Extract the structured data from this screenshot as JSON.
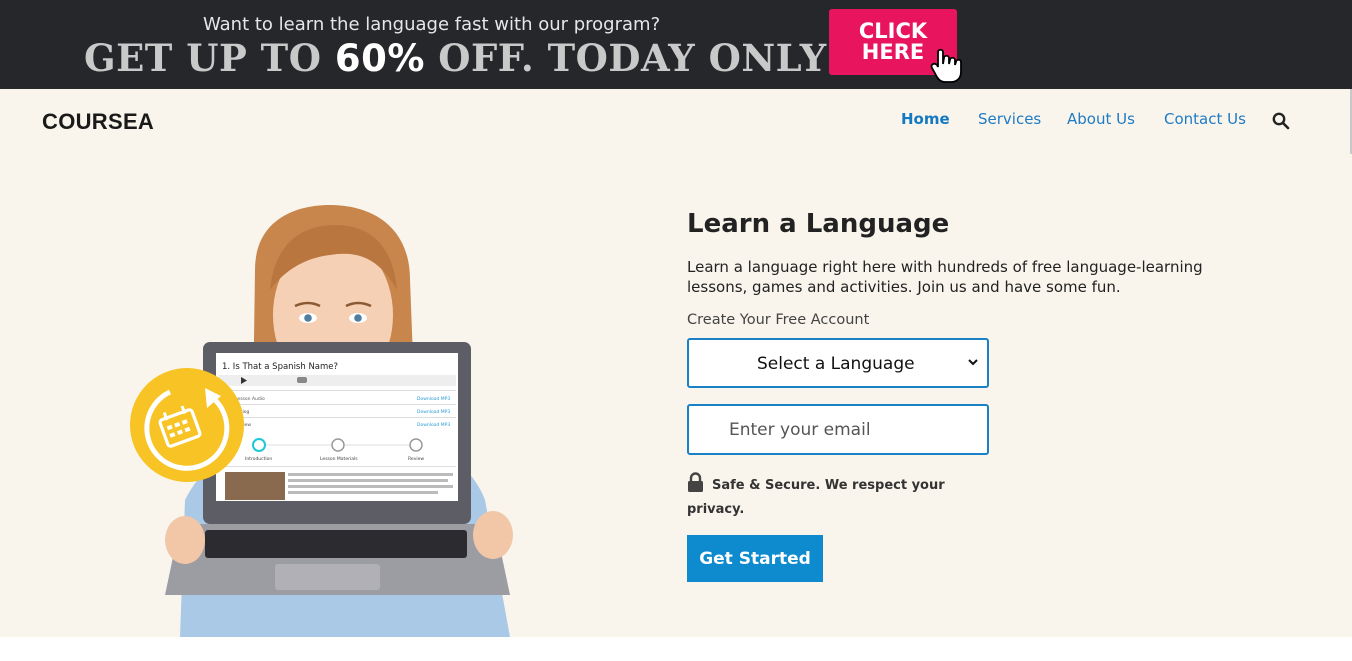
{
  "promo": {
    "line1": "Want to learn the language fast with our program?",
    "line2_prefix": "GET UP TO ",
    "line2_highlight": "60%",
    "line2_suffix": " OFF. TODAY ONLY!",
    "button_line1": "CLICK",
    "button_line2": "HERE"
  },
  "header": {
    "brand": "COURSEA",
    "nav": [
      "Home",
      "Services",
      "About Us",
      "Contact Us"
    ],
    "active_nav": "Home"
  },
  "hero": {
    "heading": "Learn a Language",
    "description": "Learn a language right here with hundreds of free language-learning lessons, games and activities. Join us and have some fun.",
    "form_label": "Create Your Free Account",
    "language_select": "Select a Language",
    "email_placeholder": "Enter your email",
    "secure_text": "Safe & Secure. We respect your privacy.",
    "cta_label": "Get Started"
  },
  "illustration": {
    "screen_title": "1. Is That a Spanish Name?",
    "row_labels": [
      "Lesson Audio",
      "Dialog",
      "Review"
    ],
    "download_label": "Download MP3",
    "steps": [
      "Introduction",
      "Lesson Materials",
      "Review"
    ],
    "lesson_text": "Learn Spanish with SpanishPod101.com! It's a new year, and you've decided you need to learn how to cook some Spanish food. Though you've lived alone for a while now, instead of learning to cook Spanish food, you've been a"
  },
  "colors": {
    "banner_bg": "#25272b",
    "promo_button": "#e8155e",
    "hero_bg": "#f9f5ec",
    "accent_blue": "#0e8bcf",
    "nav_link": "#1f7bc4",
    "badge_yellow": "#f7c325"
  },
  "icons": [
    "pointer-hand-icon",
    "search-icon",
    "chevron-down-icon",
    "lock-icon",
    "calendar-refresh-icon"
  ]
}
